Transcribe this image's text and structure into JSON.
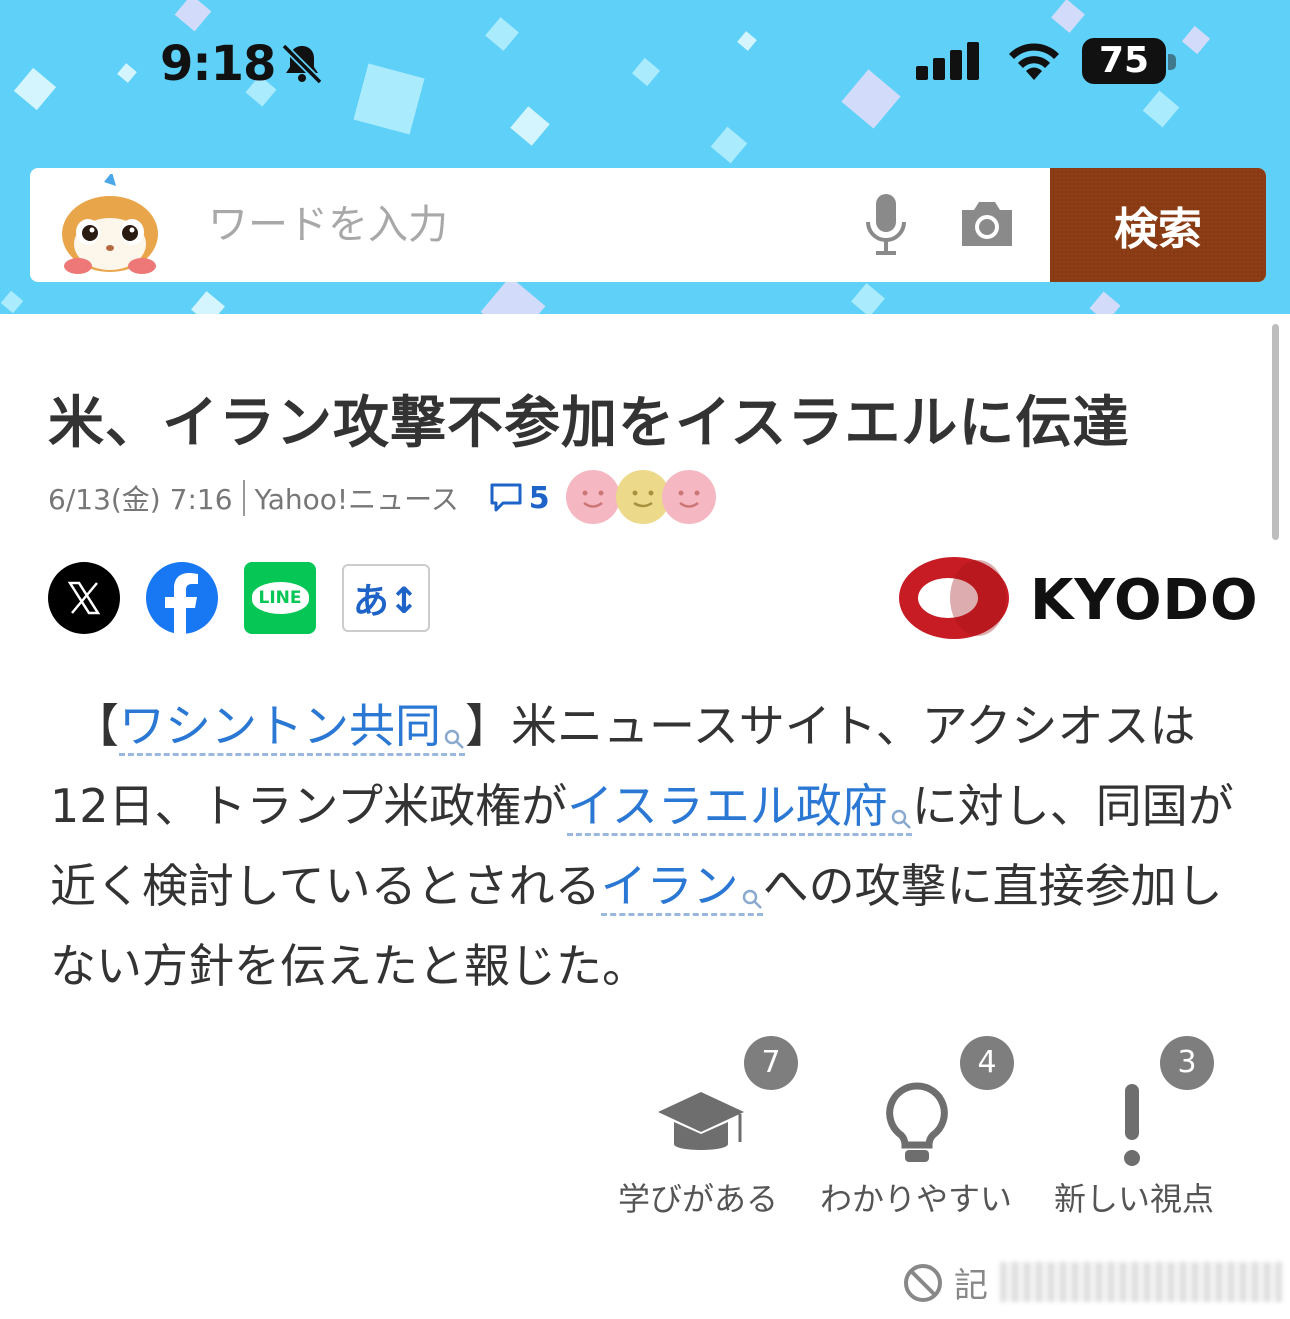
{
  "status_bar": {
    "time": "9:18",
    "battery": "75"
  },
  "search": {
    "placeholder": "ワードを入力",
    "button_label": "検索"
  },
  "article": {
    "title": "米、イラン攻撃不参加をイスラエルに伝達",
    "date": "6/13(金) 7:16",
    "source": "Yahoo!ニュース",
    "comment_count": "5",
    "publisher": "KYODO",
    "font_button": "あ↕",
    "body": {
      "p1": "【",
      "link1": "ワシントン共同",
      "p2": "】米ニュースサイト、アクシオスは12日、トランプ米政権が",
      "link2": "イスラエル政府",
      "p3": "に対し、同国が近く検討しているとされる",
      "link3": "イラン",
      "p4": "への攻撃に直接参加しない方針を伝えたと報じた。"
    }
  },
  "reactions": [
    {
      "label": "学びがある",
      "count": "7"
    },
    {
      "label": "わかりやすい",
      "count": "4"
    },
    {
      "label": "新しい視点",
      "count": "3"
    }
  ],
  "footer": {
    "report_label": "記"
  },
  "colors": {
    "header_bg": "#5fd0f8",
    "search_button": "#8a3a12",
    "link": "#2b78d4",
    "line_green": "#06c755",
    "facebook_blue": "#1877f2"
  },
  "icons": [
    "bell-slash-icon",
    "signal-icon",
    "wifi-icon",
    "battery-icon",
    "mic-icon",
    "camera-icon",
    "comment-icon",
    "x-icon",
    "facebook-icon",
    "line-icon",
    "magnifier-icon",
    "graduation-cap-icon",
    "lightbulb-icon",
    "exclamation-icon",
    "prohibited-icon"
  ]
}
